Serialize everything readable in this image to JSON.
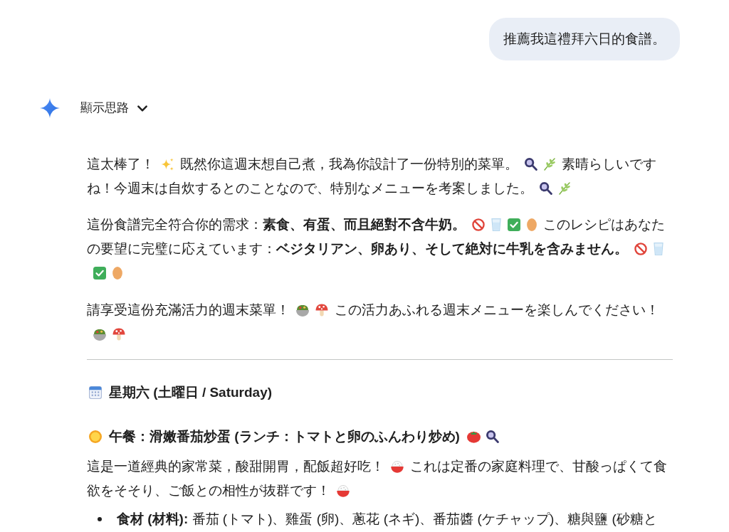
{
  "user_message": {
    "text": "推薦我這禮拜六日的食譜。"
  },
  "thoughts_toggle": {
    "label": "顯示思路",
    "expanded": false
  },
  "response": {
    "intro": [
      {
        "parts": [
          "這太棒了！",
          "既然你這週末想自己煮，我為你設計了一份特別的菜單。",
          "素晴らしいですね！今週末は自炊するとのことなので、特別なメニューを考案しました。"
        ]
      },
      {
        "parts": [
          "這份食譜完全符合你的需求：**素食、有蛋、而且絕對不含牛奶。**",
          "このレシピはあなたの要望に完璧に応えています：**ベジタリアン、卵あり、そして絶対に牛乳を含みません。**"
        ]
      },
      {
        "parts": [
          "請享受這份充滿活力的週末菜單！",
          "この活力あふれる週末メニューを楽しんでください！"
        ]
      }
    ],
    "day": {
      "title": "星期六 (土曜日 / Saturday)"
    },
    "meal": {
      "title": "午餐：滑嫩番茄炒蛋 (ランチ：トマトと卵のふんわり炒め)",
      "description": {
        "parts": [
          "這是一道經典的家常菜，酸甜開胃，配飯超好吃！",
          "これは定番の家庭料理で、甘酸っぱくて食欲をそそり、ご飯との相性が抜群です！"
        ]
      },
      "ingredients": [
        {
          "text": "**食材 (材料):** 番茄 (トマト)、雞蛋 (卵)、蔥花 (ネギ)、番茄醬 (ケチャップ)、糖與鹽 (砂糖と"
        }
      ]
    }
  }
}
